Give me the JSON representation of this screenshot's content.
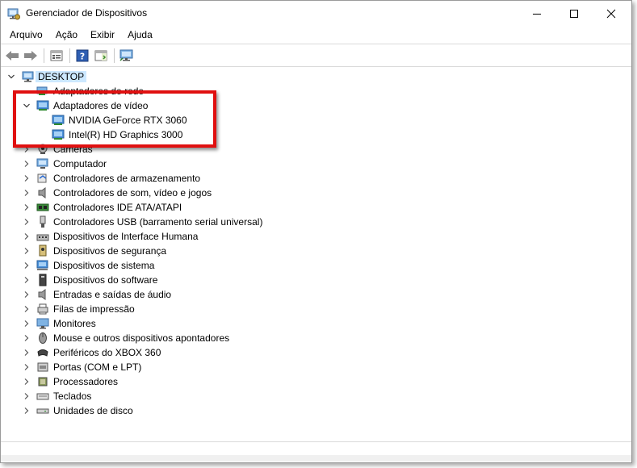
{
  "window": {
    "title": "Gerenciador de Dispositivos"
  },
  "menu": [
    {
      "label": "Arquivo"
    },
    {
      "label": "Ação"
    },
    {
      "label": "Exibir"
    },
    {
      "label": "Ajuda"
    }
  ],
  "tree": {
    "root": "DESKTOP",
    "partially_hidden_item": "Adaptadores de rede",
    "expanded_category": "Adaptadores de vídeo",
    "video_adapters": [
      "NVIDIA GeForce RTX 3060",
      "Intel(R) HD Graphics 3000"
    ],
    "cameras_label": "Câmeras",
    "categories": [
      "Computador",
      "Controladores de armazenamento",
      "Controladores de som, vídeo e jogos",
      "Controladores IDE ATA/ATAPI",
      "Controladores USB (barramento serial universal)",
      "Dispositivos de Interface Humana",
      "Dispositivos de segurança",
      "Dispositivos de sistema",
      "Dispositivos do software",
      "Entradas e saídas de áudio",
      "Filas de impressão",
      "Monitores",
      "Mouse e outros dispositivos apontadores",
      "Periféricos do XBOX 360",
      "Portas (COM e LPT)",
      "Processadores",
      "Teclados",
      "Unidades de disco"
    ]
  },
  "colors": {
    "highlight": "#e01010",
    "selection": "#cce8ff"
  }
}
